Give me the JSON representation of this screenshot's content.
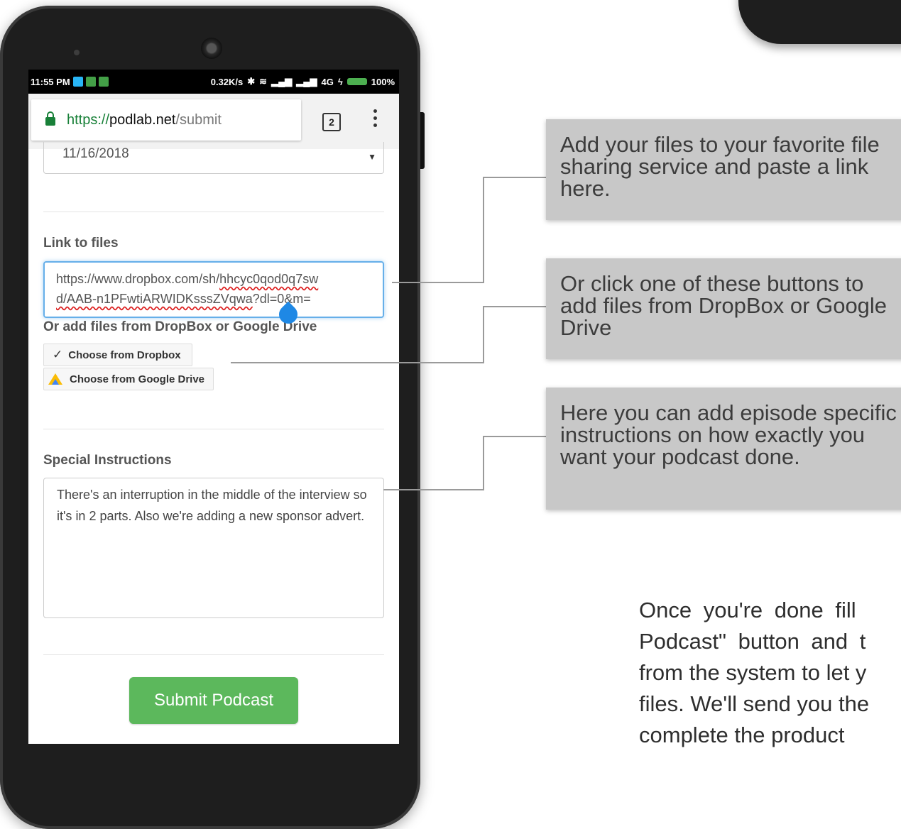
{
  "status_bar": {
    "time": "11:55 PM",
    "net_speed": "0.32K/s",
    "network": "4G",
    "battery": "100%",
    "app_icon_colors": [
      "#29b6f6",
      "#43a047",
      "#43a047"
    ]
  },
  "browser": {
    "url_scheme": "https://",
    "url_host": "podlab.net",
    "url_path": "/submit",
    "tab_count": "2"
  },
  "form": {
    "date_value": "11/16/2018",
    "link_label": "Link to files",
    "link_value_line1_a": "https://www.dropbox.com/sh/",
    "link_value_line1_b": "hhcyc0qod0q7sw",
    "link_value_line2_a": "d/AAB-n1PFwtiARWIDKsssZVqwa",
    "link_value_line2_b": "?dl=0&m=",
    "or_add_label": "Or add files from DropBox or Google Drive",
    "dropbox_button": "Choose from Dropbox",
    "gdrive_button": "Choose from Google Drive",
    "instructions_label": "Special Instructions",
    "instructions_value": "There's an interruption in the middle of the interview so it's in 2 parts. Also we're adding a new sponsor advert.",
    "submit_label": "Submit Podcast"
  },
  "callouts": {
    "link_tip": "Add your files to your favorite file sharing service and paste a link here.",
    "buttons_tip": "Or click one of these buttons to add files from DropBox or Google Drive",
    "instructions_tip": "Here you can add episode specific instructions on how exactly you want your podcast done."
  },
  "bottom_text": {
    "line1": "Once you're done fill",
    "line2": "Podcast\" button and t",
    "line3": "from the system to let y",
    "line4": "files. We'll send you the",
    "line5": "complete the product"
  },
  "colors": {
    "submit_green": "#5cb85c",
    "focus_blue": "#66afe9",
    "callout_gray": "#c8c8c8"
  }
}
